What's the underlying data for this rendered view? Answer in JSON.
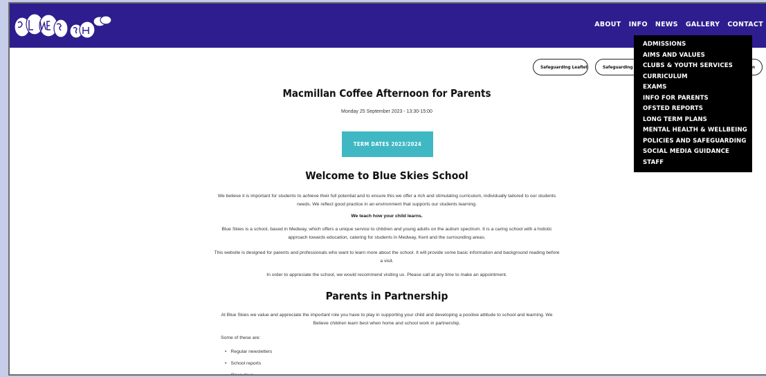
{
  "nav": {
    "items": [
      "ABOUT",
      "INFO",
      "NEWS",
      "GALLERY",
      "CONTACT"
    ]
  },
  "dropdown": {
    "items": [
      "ADMISSIONS",
      "AIMS AND VALUES",
      "CLUBS & YOUTH SERVICES",
      "CURRICULUM",
      "EXAMS",
      "INFO FOR PARENTS",
      "OFSTED REPORTS",
      "LONG TERM PLANS",
      "MENTAL HEALTH & WELLBEING",
      "POLICIES AND SAFEGUARDING",
      "SOCIAL MEDIA GUIDANCE",
      "STAFF"
    ]
  },
  "pills": [
    "Safeguarding Leaflet",
    "Safeguarding O",
    "n"
  ],
  "event": {
    "title": "Macmillan Coffee Afternoon for Parents",
    "date": "Monday 25 September 2023 - 13:30-15:00"
  },
  "term_button": "TERM DATES 2023/2024",
  "welcome": {
    "heading": "Welcome to Blue Skies School",
    "p1": "We believe it is important for students to achieve their full potential and to ensure this we offer a rich and stimulating curriculum, individually tailored to our students needs. We reflect good practice in an environment that supports our students learning.",
    "p2": "We teach how your child learns.",
    "p3": "Blue Skies is a school, based in Medway, which offers a unique service to children and young adults on the autism spectrum. It is a caring school with a holistic approach towards education, catering for students in Medway, Kent and the surrounding areas.",
    "p4": "This website is designed for parents and professionals who want to learn more about the school. It will provide some basic information and background reading before a visit.",
    "p5": "In order to appreciate the school, we would recommend visiting us. Please call at any time to make an appointment."
  },
  "partnership": {
    "heading": "Parents in Partnership",
    "p1": "At Blue Skies we value and appreciate the important role you have to play in supporting your child and developing a positive attitude to school and learning. We Believe children learn best when home and school work in partnership.",
    "intro": "Some of these are:",
    "items": [
      "Regular newsletters",
      "School reports",
      "Open days"
    ]
  },
  "colors": {
    "header": "#2e1d8e",
    "accent": "#3fb8c4",
    "dropdown": "#000000"
  }
}
